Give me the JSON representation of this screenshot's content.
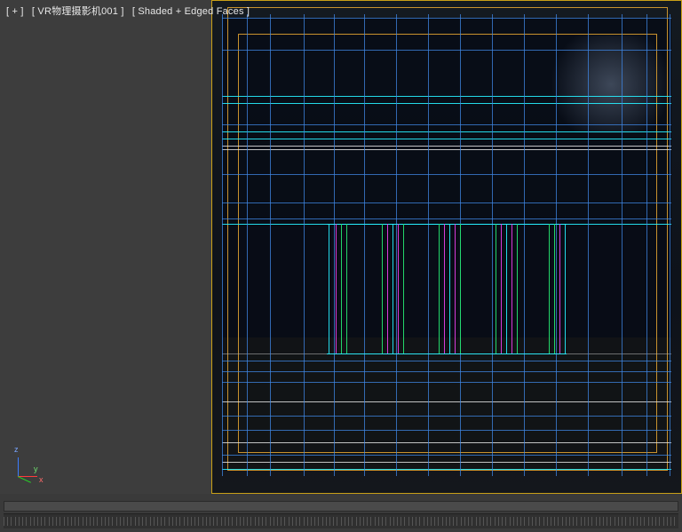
{
  "viewport_label": {
    "maximize": "[ + ]",
    "camera": "[ VR物理摄影机001 ]",
    "shading": "[ Shaded + Edged Faces ]"
  },
  "axis_gizmo": {
    "x": "x",
    "y": "y",
    "z": "z"
  },
  "colors": {
    "active_viewport_border": "#c9a017",
    "safe_frame": "#c8922e",
    "wire_blue": "#3f87e6",
    "wire_cyan": "#27f0ff",
    "wire_white": "#e0e0e0",
    "wire_green": "#25e06e",
    "wire_magenta": "#e43de4",
    "bg_dark": "#10151d"
  },
  "timeline": {
    "tick_count": 180
  }
}
